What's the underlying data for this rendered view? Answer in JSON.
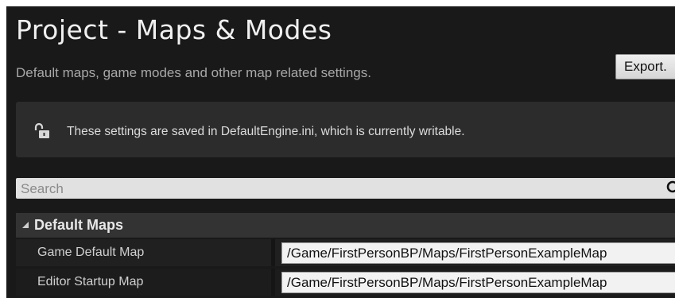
{
  "header": {
    "title": "Project - Maps & Modes",
    "subtitle": "Default maps, game modes and other map related settings.",
    "export_label": "Export."
  },
  "notice": {
    "icon": "unlocked-padlock-icon",
    "text": "These settings are saved in DefaultEngine.ini, which is currently writable."
  },
  "search": {
    "placeholder": "Search",
    "value": "",
    "icon": "magnifier-icon"
  },
  "section": {
    "title": "Default Maps",
    "expanded": true,
    "properties": [
      {
        "label": "Game Default Map",
        "value": "/Game/FirstPersonBP/Maps/FirstPersonExampleMap"
      },
      {
        "label": "Editor Startup Map",
        "value": "/Game/FirstPersonBP/Maps/FirstPersonExampleMap"
      }
    ]
  },
  "colors": {
    "panel_bg": "#191919",
    "notice_bg": "#2c2c2c",
    "section_bg": "#333333",
    "search_bg": "#e1e1e1"
  }
}
